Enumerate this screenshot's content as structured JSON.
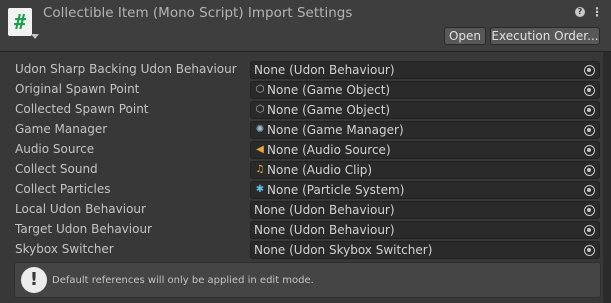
{
  "header": {
    "script_icon_glyph": "#",
    "title": "Collectible Item (Mono Script) Import Settings",
    "help_glyph": "?",
    "menu_glyph": "⋮",
    "open_label": "Open",
    "execution_order_label": "Execution Order..."
  },
  "fields": [
    {
      "label": "Udon Sharp Backing Udon Behaviour",
      "value": "None (Udon Behaviour)",
      "icon": ""
    },
    {
      "label": "Original Spawn Point",
      "value": "None (Game Object)",
      "icon": "game-object-icon"
    },
    {
      "label": "Collected Spawn Point",
      "value": "None (Game Object)",
      "icon": "game-object-icon"
    },
    {
      "label": "Game Manager",
      "value": "None (Game Manager)",
      "icon": "script-component-icon"
    },
    {
      "label": "Audio Source",
      "value": "None (Audio Source)",
      "icon": "audio-source-icon"
    },
    {
      "label": "Collect Sound",
      "value": "None (Audio Clip)",
      "icon": "audio-clip-icon"
    },
    {
      "label": "Collect Particles",
      "value": "None (Particle System)",
      "icon": "particle-system-icon"
    },
    {
      "label": "Local Udon Behaviour",
      "value": "None (Udon Behaviour)",
      "icon": ""
    },
    {
      "label": "Target Udon Behaviour",
      "value": "None (Udon Behaviour)",
      "icon": ""
    },
    {
      "label": "Skybox Switcher",
      "value": "None (Udon Skybox Switcher)",
      "icon": ""
    }
  ],
  "helpbox": {
    "glyph": "!",
    "text": "Default references will only be applied in edit mode."
  },
  "colors": {
    "panel_bg": "#383838",
    "field_bg": "#2a2a2a",
    "button_bg": "#585858",
    "script_icon_green": "#1f9e4c"
  }
}
